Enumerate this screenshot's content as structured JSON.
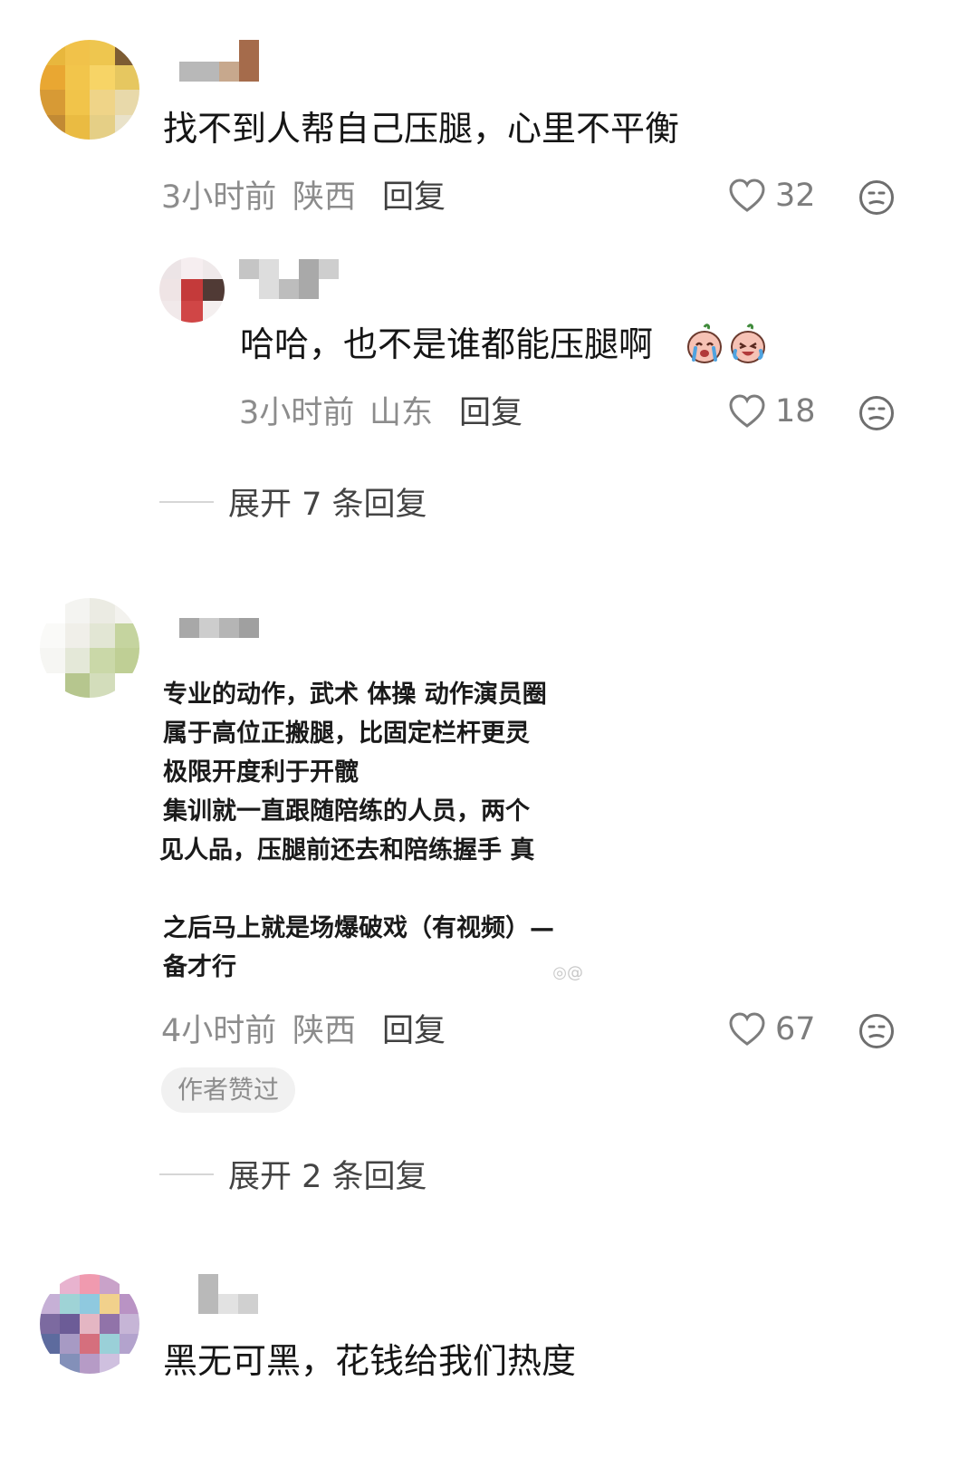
{
  "comments": [
    {
      "text": "找不到人帮自己压腿，心里不平衡",
      "time": "3小时前",
      "location": "陕西",
      "reply_label": "回复",
      "likes": "32",
      "replies": [
        {
          "text": "哈哈，也不是谁都能压腿啊",
          "time": "3小时前",
          "location": "山东",
          "reply_label": "回复",
          "likes": "18",
          "emojis": [
            "crying-face",
            "laughing-crying-face"
          ]
        }
      ],
      "expand_label": "展开 7 条回复"
    },
    {
      "image_text": [
        "专业的动作，武术 体操 动作演员圈",
        "属于高位正搬腿，比固定栏杆更灵",
        "极限开度利于开髋",
        "集训就一直跟随陪练的人员，两个",
        "见人品，压腿前还去和陪练握手 真",
        "",
        "之后马上就是场爆破戏（有视频）—",
        "备才行"
      ],
      "time": "4小时前",
      "location": "陕西",
      "reply_label": "回复",
      "likes": "67",
      "badge": "作者赞过",
      "expand_label": "展开 2 条回复"
    },
    {
      "text": "黑无可黑，花钱给我们热度"
    }
  ],
  "icons": {
    "like": "heart-outline-icon",
    "dislike": "neutral-face-icon"
  },
  "colors": {
    "text": "#151515",
    "meta": "#8c8c8c",
    "badge_bg": "#f1f1f1"
  }
}
